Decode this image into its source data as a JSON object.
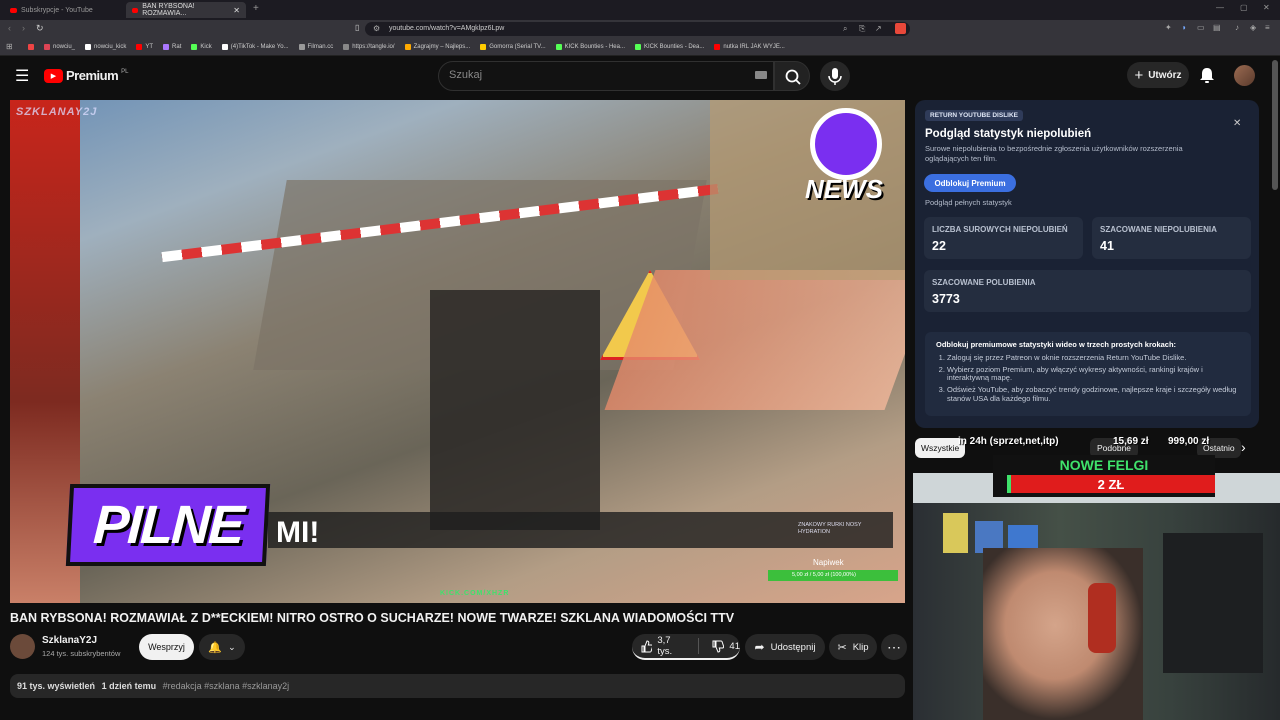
{
  "browser": {
    "tabs": [
      {
        "label": "Subskrypcje - YouTube"
      },
      {
        "label": "BAN RYBSONA! ROZMAWIA..."
      }
    ],
    "url": "youtube.com/watch?v=AMgklpz6Lpw",
    "bookmarks": [
      "nowciu_",
      "nowciu_kick",
      "YT",
      "Rat",
      "Kick",
      "(4)TikTok - Make Yo...",
      "Filman.cc",
      "https://tangle.io/",
      "Zagrajmy – Najleps...",
      "Gomorra (Serial TV...",
      "KICK Bounties - Hea...",
      "KICK Bounties - Dea...",
      "nutka IRL JAK WYJE..."
    ]
  },
  "header": {
    "logo": "Premium",
    "region": "PL",
    "search_placeholder": "Szukaj",
    "create_label": "Utwórz"
  },
  "video": {
    "watermark": "SZKLANAY2J",
    "pilne": "PILNE",
    "ticker": "MI!",
    "news_logo": "NEWS",
    "kick_url": "KICK.COM/XHZR",
    "tip_label": "Napiwek",
    "tip_values": "5,00 zł / 5,00 zł (100,00%)",
    "sponsor": "ZNAKOWY RURKI NOSY HYDRATION"
  },
  "meta": {
    "title": "BAN RYBSONA! ROZMAWIAŁ Z D**ECKIEM! NITRO OSTRO O SUCHARZE! NOWE TWARZE! SZKLANA WIADOMOŚCI TTV",
    "channel": "SzklanaY2J",
    "subscribers": "124 tys. subskrybentów",
    "support_label": "Wesprzyj",
    "likes": "3,7 tys.",
    "dislikes": "41",
    "share_label": "Udostępnij",
    "clip_label": "Klip",
    "views": "91 tys. wyświetleń",
    "age": "1 dzień temu",
    "tags": "#redakcja #szklana #szklanay2j"
  },
  "ryd": {
    "badge": "RETURN YOUTUBE DISLIKE",
    "title": "Podgląd statystyk niepolubień",
    "desc": "Surowe niepolubienia to bezpośrednie zgłoszenia użytkowników rozszerzenia oglądających ten film.",
    "unlock_label": "Odblokuj Premium",
    "preview_label": "Podgląd pełnych statystyk",
    "raw_label": "LICZBA SUROWYCH NIEPOLUBIEŃ",
    "raw_value": "22",
    "est_dislikes_label": "SZACOWANE NIEPOLUBIENIA",
    "est_dislikes_value": "41",
    "est_likes_label": "SZACOWANE POLUBIENIA",
    "est_likes_value": "3773",
    "steps_title": "Odblokuj premiumowe statystyki wideo w trzech prostych krokach:",
    "steps": [
      "Zaloguj się przez Patreon w oknie rozszerzenia Return YouTube Dislike.",
      "Wybierz poziom Premium, aby włączyć wykresy aktywności, rankingi krajów i interaktywną mapę.",
      "Odśwież YouTube, aby zobaczyć trendy godzinowe, najlepsze kraje i szczegóły według stanów USA dla każdego filmu."
    ]
  },
  "chips": {
    "all": "Wszystkie",
    "similar": "Podobne",
    "recent": "Ostatnio"
  },
  "stream_overlay": {
    "goal_title": "in 24h (sprzet,net,itp)",
    "goal_progress": "15,69 zł",
    "goal_target": "999,00 zł",
    "felgi_title": "NOWE FELGI",
    "felgi_amount": "2 ZŁ",
    "felgi_progress": 0.02
  }
}
